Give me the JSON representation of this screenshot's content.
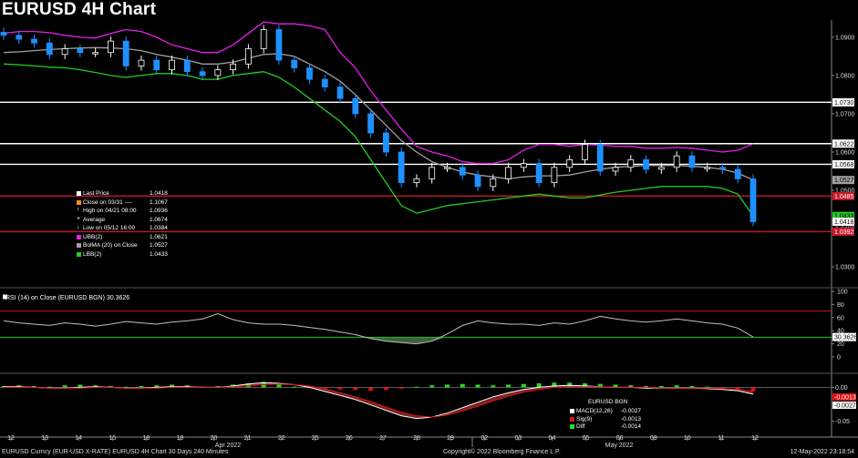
{
  "title": "EURUSD 4H Chart",
  "colors": {
    "price_up": "#ffffff",
    "price_down": "#1e90ff",
    "ubb": "#e81ee8",
    "lbb": "#22cc22",
    "bolma": "#a0a0a0",
    "hline": "#ffffff",
    "red_line": "#c8182a",
    "rsi": "#c0c0c0",
    "macd_up": "#22dd22",
    "macd_down": "#dd1111"
  },
  "legend": [
    {
      "label": "Last Price",
      "value": "1.0418",
      "color": "#ffffff"
    },
    {
      "label": "Close on 03/31 ----",
      "value": "1.1067",
      "color": "#ff8c1a"
    },
    {
      "label": "High on 04/21 08:00",
      "value": "1.0936",
      "color": "#ffffff",
      "marker": "↑"
    },
    {
      "label": "Average",
      "value": "1.0674",
      "color": "#ffffff",
      "marker": "+"
    },
    {
      "label": "Low on 05/12 16:00",
      "value": "1.0384",
      "color": "#ffffff",
      "marker": "↓"
    },
    {
      "label": "UBB(2)",
      "value": "1.0621",
      "color": "#e81ee8"
    },
    {
      "label": "BolMA (20)  on Close",
      "value": "1.0527",
      "color": "#a0a0a0"
    },
    {
      "label": "LBB(2)",
      "value": "1.0433",
      "color": "#22cc22"
    }
  ],
  "rsi_label": "RSI (14)  on Close (EURUSD BGN) 30.3626",
  "macd_legend": {
    "title": "EURUSD BGN",
    "rows": [
      {
        "label": "MACD(12,26)",
        "value": "-0.0027",
        "color": "#ffffff"
      },
      {
        "label": "Sig(9)",
        "value": "-0.0013",
        "color": "#dd1111"
      },
      {
        "label": "Diff",
        "value": "-0.0014",
        "color": "#22dd22"
      }
    ]
  },
  "footer": {
    "left": "EURUSD Curncy (EUR-USD X-RATE) EURUSD 4H Chart 30 Days 240 Minutes",
    "center": "Copyright© 2022 Bloomberg Finance L.P.",
    "right": "12-May-2022 23:18:54"
  },
  "chart_data": {
    "type": "line",
    "x_ticks": [
      "12",
      "13",
      "14",
      "15",
      "18",
      "19",
      "20",
      "21",
      "22",
      "25",
      "26",
      "27",
      "28",
      "29",
      "02",
      "03",
      "04",
      "05",
      "06",
      "09",
      "10",
      "11",
      "12"
    ],
    "month_labels": [
      "Apr 2022",
      "May 2022"
    ],
    "price_axis": {
      "ticks": [
        "1.0900",
        "1.0800",
        "1.0700",
        "1.0600",
        "1.0500",
        "1.0400",
        "1.0300"
      ],
      "ylim": [
        1.0255,
        1.0945
      ]
    },
    "reference_lines": [
      {
        "value": 1.073,
        "label": "1.0730",
        "color": "#ffffff"
      },
      {
        "value": 1.0622,
        "label": "1.0622",
        "color": "#ffffff"
      },
      {
        "value": 1.0568,
        "label": "1.0568",
        "color": "#ffffff"
      },
      {
        "value": 1.0485,
        "label": "1.0485",
        "color": "#c8182a"
      },
      {
        "value": 1.0392,
        "label": "1.0392",
        "color": "#c8182a"
      }
    ],
    "value_tags": [
      {
        "value": 1.0527,
        "label": "1.0527",
        "color": "#a0a0a0"
      },
      {
        "value": 1.0433,
        "label": "1.0433",
        "color": "#22cc22"
      },
      {
        "value": 1.0418,
        "label": "1.0418",
        "color": "#000000"
      }
    ],
    "series": [
      {
        "name": "Last Price",
        "values": [
          1.0905,
          1.0895,
          1.0885,
          1.0855,
          1.087,
          1.086,
          1.086,
          1.089,
          1.0825,
          1.084,
          1.0815,
          1.084,
          1.081,
          1.08,
          1.0815,
          1.083,
          1.087,
          1.092,
          1.084,
          1.082,
          1.079,
          1.077,
          1.074,
          1.07,
          1.065,
          1.06,
          1.052,
          1.053,
          1.056,
          1.056,
          1.054,
          1.051,
          1.053,
          1.056,
          1.057,
          1.052,
          1.056,
          1.058,
          1.062,
          1.055,
          1.056,
          1.058,
          1.0555,
          1.056,
          1.059,
          1.056,
          1.056,
          1.0555,
          1.053,
          1.0418
        ]
      },
      {
        "name": "UBB(2)",
        "values": [
          1.091,
          1.0915,
          1.0915,
          1.0912,
          1.0905,
          1.09,
          1.0898,
          1.091,
          1.092,
          1.0915,
          1.09,
          1.088,
          1.087,
          1.086,
          1.086,
          1.088,
          1.091,
          1.094,
          1.0935,
          1.0935,
          1.093,
          1.092,
          1.086,
          1.082,
          1.076,
          1.071,
          1.066,
          1.0615,
          1.06,
          1.059,
          1.0575,
          1.057,
          1.057,
          1.058,
          1.0605,
          1.062,
          1.062,
          1.0615,
          1.062,
          1.0618,
          1.0615,
          1.0615,
          1.061,
          1.061,
          1.0612,
          1.061,
          1.0605,
          1.06,
          1.0605,
          1.0621
        ]
      },
      {
        "name": "BolMA (20) on Close",
        "values": [
          1.086,
          1.0862,
          1.0865,
          1.0868,
          1.087,
          1.0872,
          1.0873,
          1.0872,
          1.087,
          1.0865,
          1.0855,
          1.0848,
          1.084,
          1.083,
          1.083,
          1.0835,
          1.0845,
          1.0855,
          1.0857,
          1.085,
          1.083,
          1.081,
          1.0785,
          1.075,
          1.071,
          1.067,
          1.063,
          1.06,
          1.0575,
          1.056,
          1.0548,
          1.054,
          1.0535,
          1.053,
          1.0535,
          1.0538,
          1.0538,
          1.054,
          1.0548,
          1.0555,
          1.056,
          1.0563,
          1.0565,
          1.0565,
          1.0565,
          1.0563,
          1.056,
          1.0555,
          1.0545,
          1.0527
        ]
      },
      {
        "name": "LBB(2)",
        "values": [
          1.083,
          1.0828,
          1.0825,
          1.0822,
          1.082,
          1.0815,
          1.0808,
          1.08,
          1.0795,
          1.08,
          1.0805,
          1.0805,
          1.08,
          1.079,
          1.079,
          1.08,
          1.0805,
          1.081,
          1.0795,
          1.077,
          1.074,
          1.071,
          1.068,
          1.064,
          1.058,
          1.052,
          1.046,
          1.044,
          1.045,
          1.046,
          1.0465,
          1.047,
          1.0475,
          1.048,
          1.0485,
          1.049,
          1.0485,
          1.048,
          1.048,
          1.0488,
          1.0495,
          1.05,
          1.0505,
          1.051,
          1.051,
          1.051,
          1.051,
          1.0505,
          1.049,
          1.0433
        ]
      }
    ],
    "rsi": {
      "ticks": [
        "100",
        "80",
        "60",
        "40",
        "20",
        "0"
      ],
      "ylim": [
        0,
        100
      ],
      "levels": [
        70,
        30
      ],
      "last_label": "30.3626",
      "values": [
        55,
        52,
        50,
        48,
        52,
        50,
        47,
        50,
        54,
        52,
        50,
        53,
        55,
        58,
        66,
        57,
        52,
        50,
        50,
        48,
        45,
        42,
        38,
        34,
        28,
        24,
        22,
        20,
        24,
        35,
        48,
        55,
        52,
        50,
        50,
        48,
        52,
        50,
        55,
        62,
        58,
        55,
        53,
        55,
        58,
        55,
        52,
        50,
        44,
        30.3626
      ]
    },
    "macd": {
      "ticks": [
        "0.00",
        "-0.0013",
        "-0.0027",
        "-0.05"
      ],
      "ylim": [
        -0.06,
        0.01
      ],
      "hist": [
        0.002,
        0.003,
        0.002,
        0.001,
        0.003,
        0.004,
        0.003,
        0.002,
        0.001,
        0.002,
        0.003,
        0.004,
        0.003,
        0.001,
        0.002,
        0.004,
        0.006,
        0.008,
        0.005,
        0.001,
        -0.001,
        -0.002,
        -0.003,
        -0.004,
        -0.005,
        -0.004,
        -0.002,
        0.001,
        0.003,
        0.004,
        0.005,
        0.004,
        0.003,
        0.004,
        0.005,
        0.006,
        0.007,
        0.007,
        0.006,
        0.005,
        0.004,
        0.003,
        0.002,
        0.002,
        0.003,
        0.002,
        0.001,
        -0.001,
        -0.003,
        -0.006
      ],
      "macd_line": [
        0.001,
        0.001,
        0.0,
        -0.001,
        -0.001,
        0.0,
        0.001,
        0.0,
        -0.001,
        -0.001,
        0.0,
        0.001,
        0.001,
        0.0,
        0.0,
        0.002,
        0.005,
        0.007,
        0.006,
        0.004,
        0.0,
        -0.006,
        -0.012,
        -0.018,
        -0.026,
        -0.034,
        -0.042,
        -0.046,
        -0.044,
        -0.038,
        -0.03,
        -0.022,
        -0.014,
        -0.008,
        -0.003,
        0.0,
        0.002,
        0.003,
        0.002,
        0.001,
        0.0,
        0.0,
        -0.001,
        -0.001,
        -0.001,
        -0.001,
        -0.002,
        -0.003,
        -0.005,
        -0.01
      ],
      "signal_line": [
        0.0,
        0.0,
        0.0,
        -0.001,
        -0.001,
        -0.001,
        0.0,
        0.0,
        -0.001,
        -0.001,
        -0.001,
        0.0,
        0.0,
        0.0,
        0.0,
        0.001,
        0.002,
        0.004,
        0.005,
        0.004,
        0.002,
        -0.002,
        -0.008,
        -0.014,
        -0.021,
        -0.029,
        -0.037,
        -0.042,
        -0.044,
        -0.041,
        -0.035,
        -0.028,
        -0.02,
        -0.013,
        -0.007,
        -0.003,
        0.0,
        0.001,
        0.001,
        0.001,
        0.0,
        0.0,
        0.0,
        -0.001,
        -0.001,
        -0.001,
        -0.001,
        -0.002,
        -0.003,
        -0.006
      ]
    }
  }
}
